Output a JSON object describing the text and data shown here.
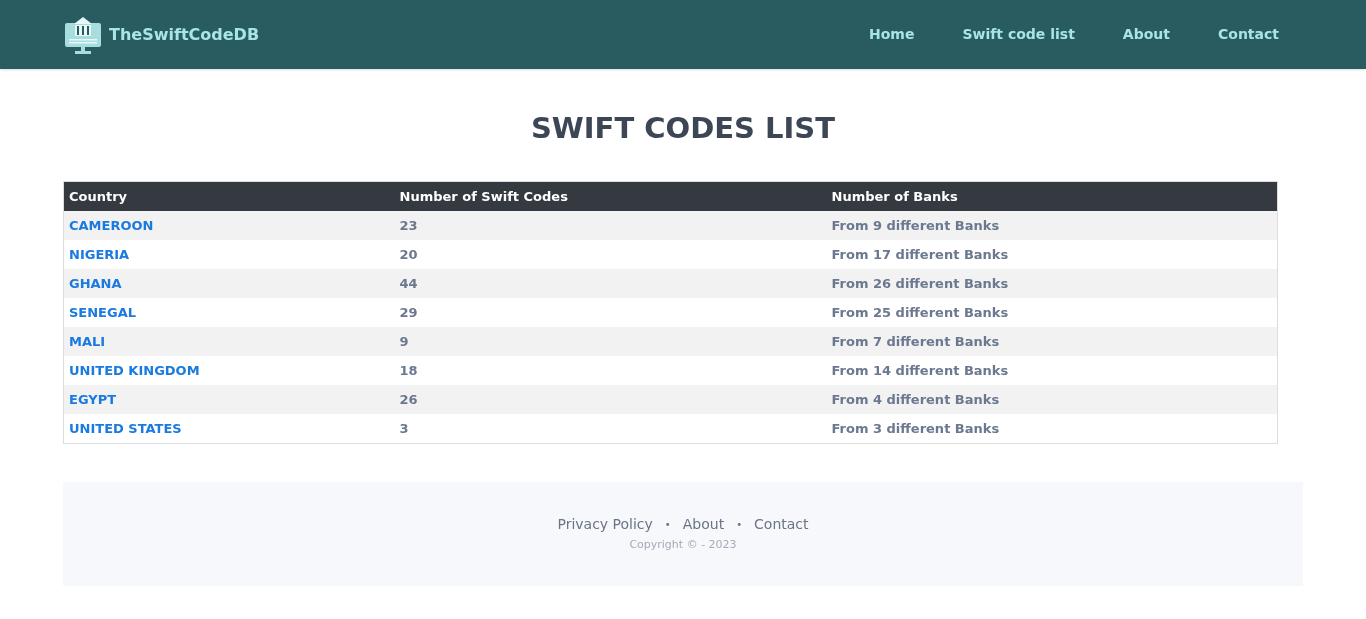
{
  "header": {
    "logo_text": "TheSwiftCodeDB",
    "nav": [
      "Home",
      "Swift code list",
      "About",
      "Contact"
    ]
  },
  "title": "SWIFT CODES LIST",
  "table": {
    "columns": [
      "Country",
      "Number of Swift Codes",
      "Number of Banks"
    ],
    "rows": [
      [
        "CAMEROON",
        "23",
        "From 9 different Banks"
      ],
      [
        "NIGERIA",
        "20",
        "From 17 different Banks"
      ],
      [
        "GHANA",
        "44",
        "From 26 different Banks"
      ],
      [
        "SENEGAL",
        "29",
        "From 25 different Banks"
      ],
      [
        "MALI",
        "9",
        "From 7 different Banks"
      ],
      [
        "UNITED KINGDOM",
        "18",
        "From 14 different Banks"
      ],
      [
        "EGYPT",
        "26",
        "From 4 different Banks"
      ],
      [
        "UNITED STATES",
        "3",
        "From 3 different Banks"
      ]
    ]
  },
  "footer": {
    "links": [
      "Privacy Policy",
      "About",
      "Contact"
    ],
    "separator": "•",
    "copyright": "Copyright © - 2023"
  }
}
